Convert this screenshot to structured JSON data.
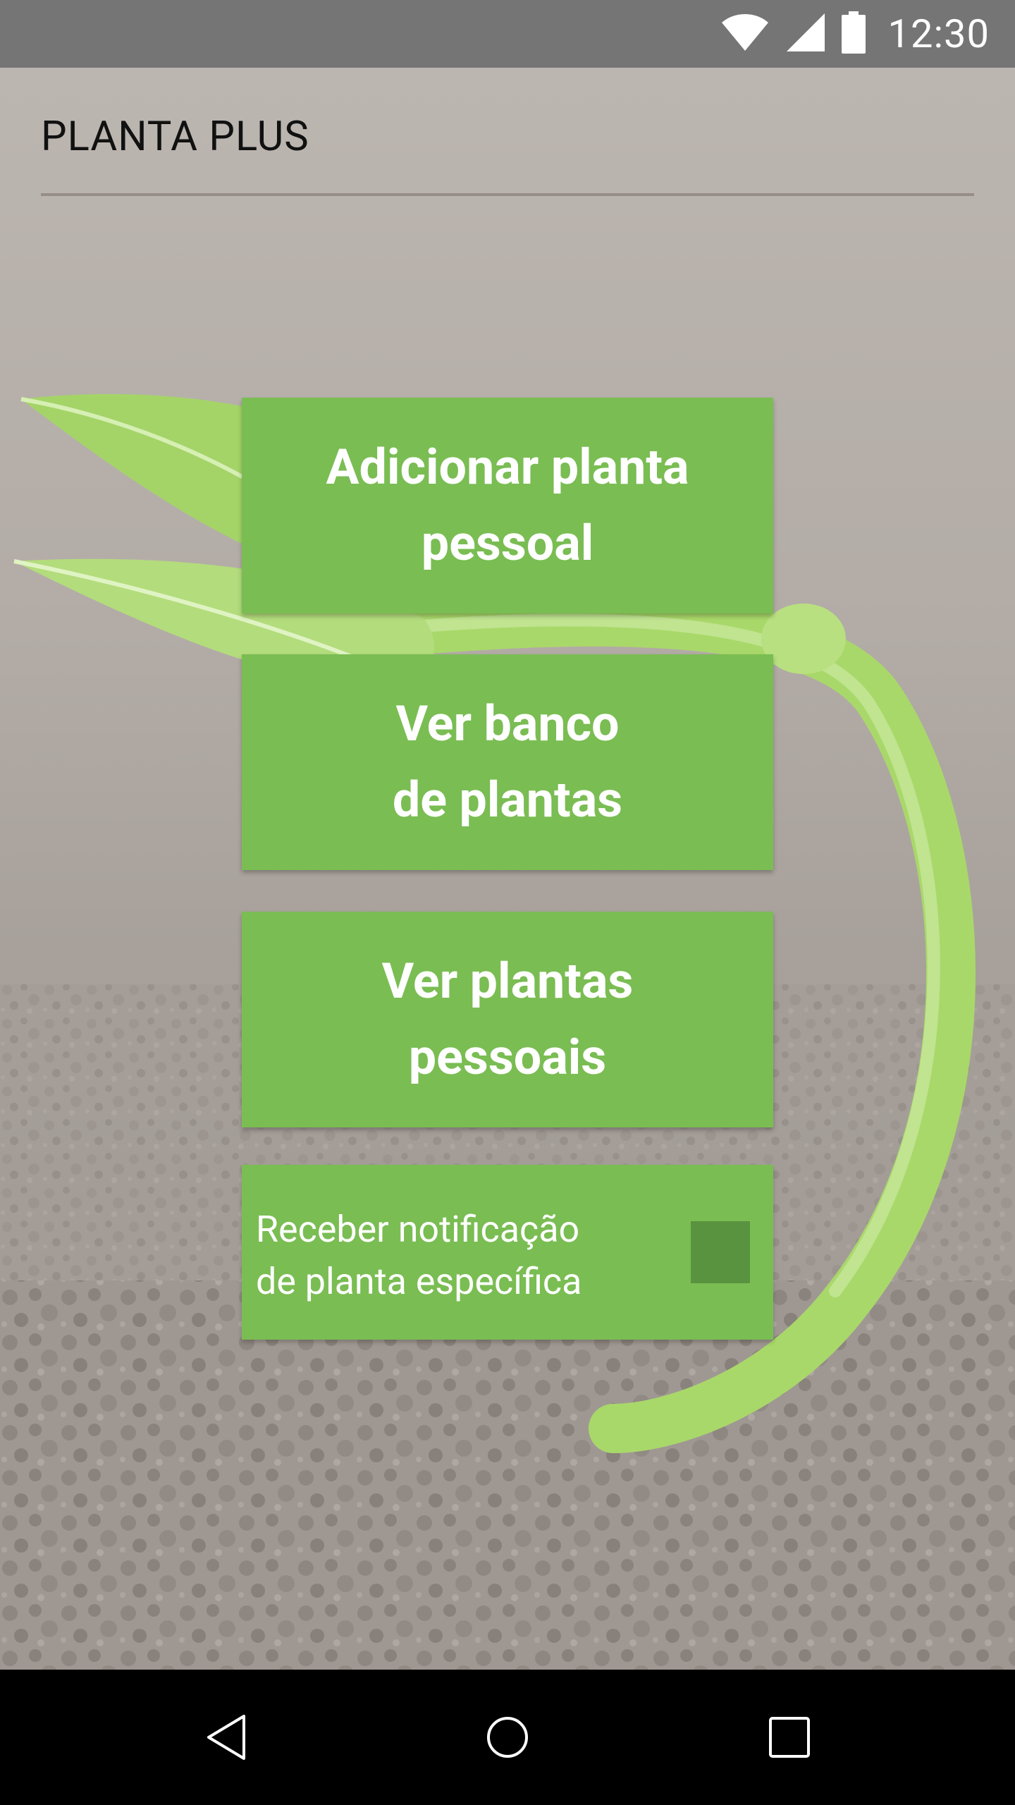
{
  "status_bar": {
    "time": "12:30",
    "icons": [
      "wifi-icon",
      "cell-signal-icon",
      "battery-icon"
    ]
  },
  "app": {
    "title": "PLANTA PLUS"
  },
  "menu": {
    "add_plant_label": "Adicionar planta\npessoal",
    "view_bank_label": "Ver banco\nde plantas",
    "view_personal_label": "Ver plantas\npessoais"
  },
  "notification": {
    "label": "Receber notificação\nde planta específica",
    "checked": false
  },
  "nav_bar": {
    "icons": [
      "back-icon",
      "home-icon",
      "recents-icon"
    ]
  },
  "colors": {
    "status_bar": "#757575",
    "button_green": "#7abd53",
    "checkbox_green": "#5a9340",
    "nav_bar": "#000000"
  }
}
